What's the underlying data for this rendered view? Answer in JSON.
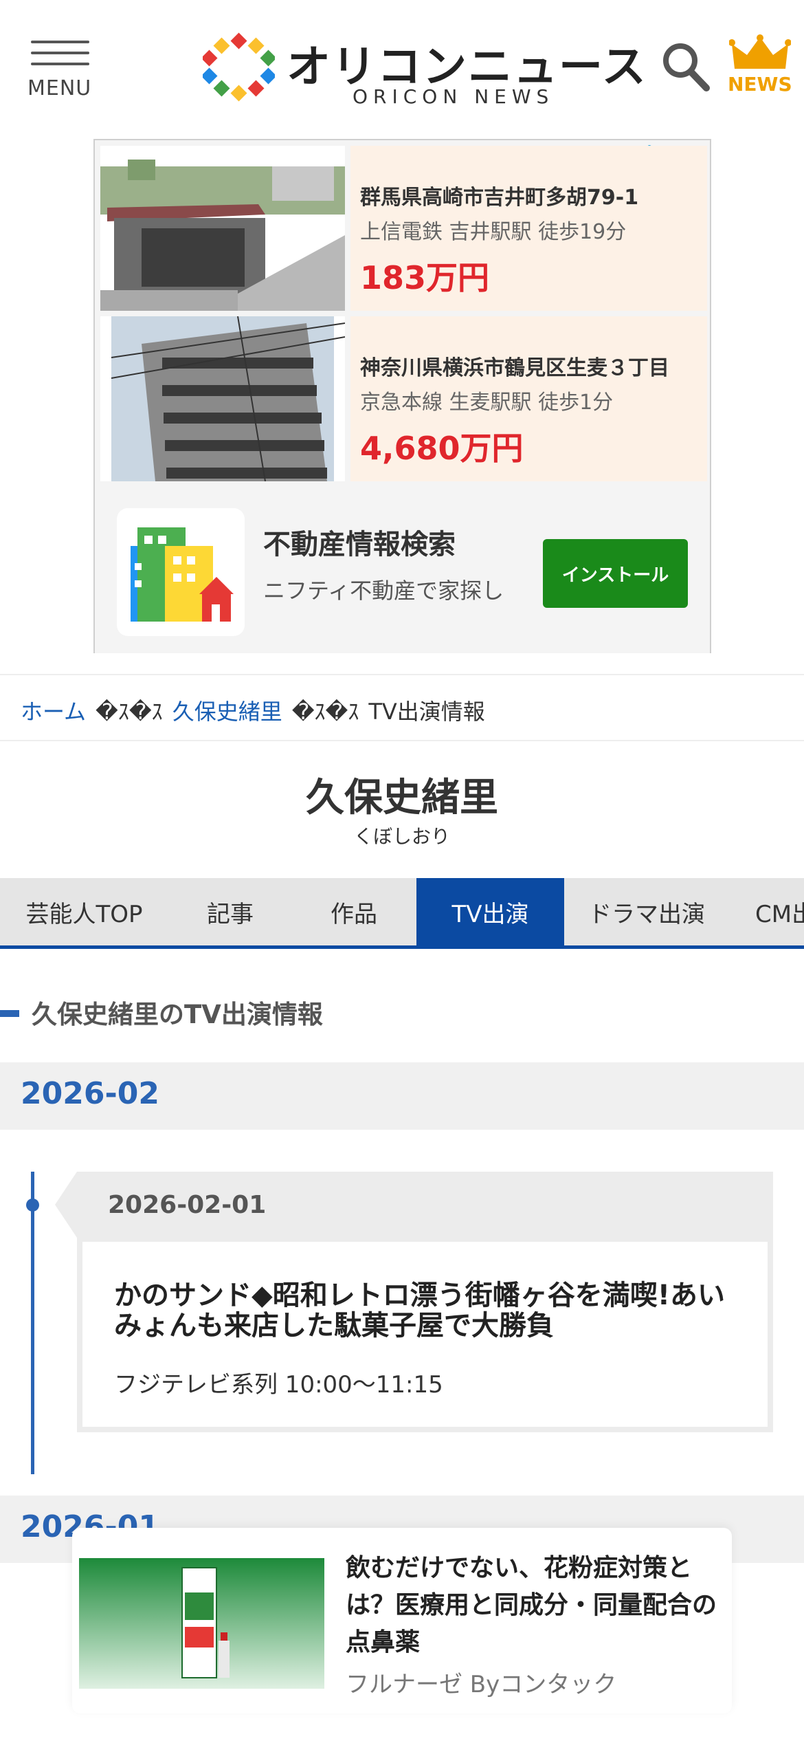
{
  "header": {
    "menu_label": "MENU",
    "logo_text": "オリコンニュース",
    "logo_sub": "ORICON NEWS",
    "news_label": "NEWS"
  },
  "ad": {
    "listings": [
      {
        "address": "群馬県高崎市吉井町多胡79-1",
        "station": "上信電鉄 吉井駅駅 徒歩19分",
        "price": "183万円"
      },
      {
        "address": "神奈川県横浜市鶴見区生麦３丁目",
        "station": "京急本線 生麦駅駅 徒歩1分",
        "price": "4,680万円"
      }
    ],
    "app_title": "不動産情報検索",
    "app_sub": "ニフティ不動産で家探し",
    "install_label": "インストール"
  },
  "breadcrumb": {
    "home": "ホーム",
    "sep": "�ｽ�ｽ",
    "artist": "久保史緒里",
    "current": "TV出演情報"
  },
  "artist": {
    "name": "久保史緒里",
    "kana": "くぼしおり"
  },
  "tabs": [
    {
      "label": "芸能人TOP"
    },
    {
      "label": "記事"
    },
    {
      "label": "作品"
    },
    {
      "label": "TV出演"
    },
    {
      "label": "ドラマ出演"
    },
    {
      "label": "CM出演"
    }
  ],
  "section": {
    "title": "久保史緒里のTV出演情報"
  },
  "months": [
    {
      "label": "2026-02",
      "entries": [
        {
          "date": "2026-02-01",
          "title": "かのサンド◆昭和レトロ漂う街幡ヶ谷を満喫!あいみょんも来店した駄菓子屋で大勝負",
          "meta": "フジテレビ系列 10:00〜11:15"
        }
      ]
    },
    {
      "label": "2026-01"
    }
  ],
  "recommend": {
    "title": "飲むだけでない、花粉症対策とは？医療用と同成分・同量配合の点鼻薬",
    "sponsor": "フルナーゼ Byコンタック"
  },
  "colors": {
    "accent": "#0b4aa2",
    "link": "#1a5fb4",
    "price": "#e0262c",
    "news": "#f0a000",
    "install": "#1a8a1a"
  }
}
